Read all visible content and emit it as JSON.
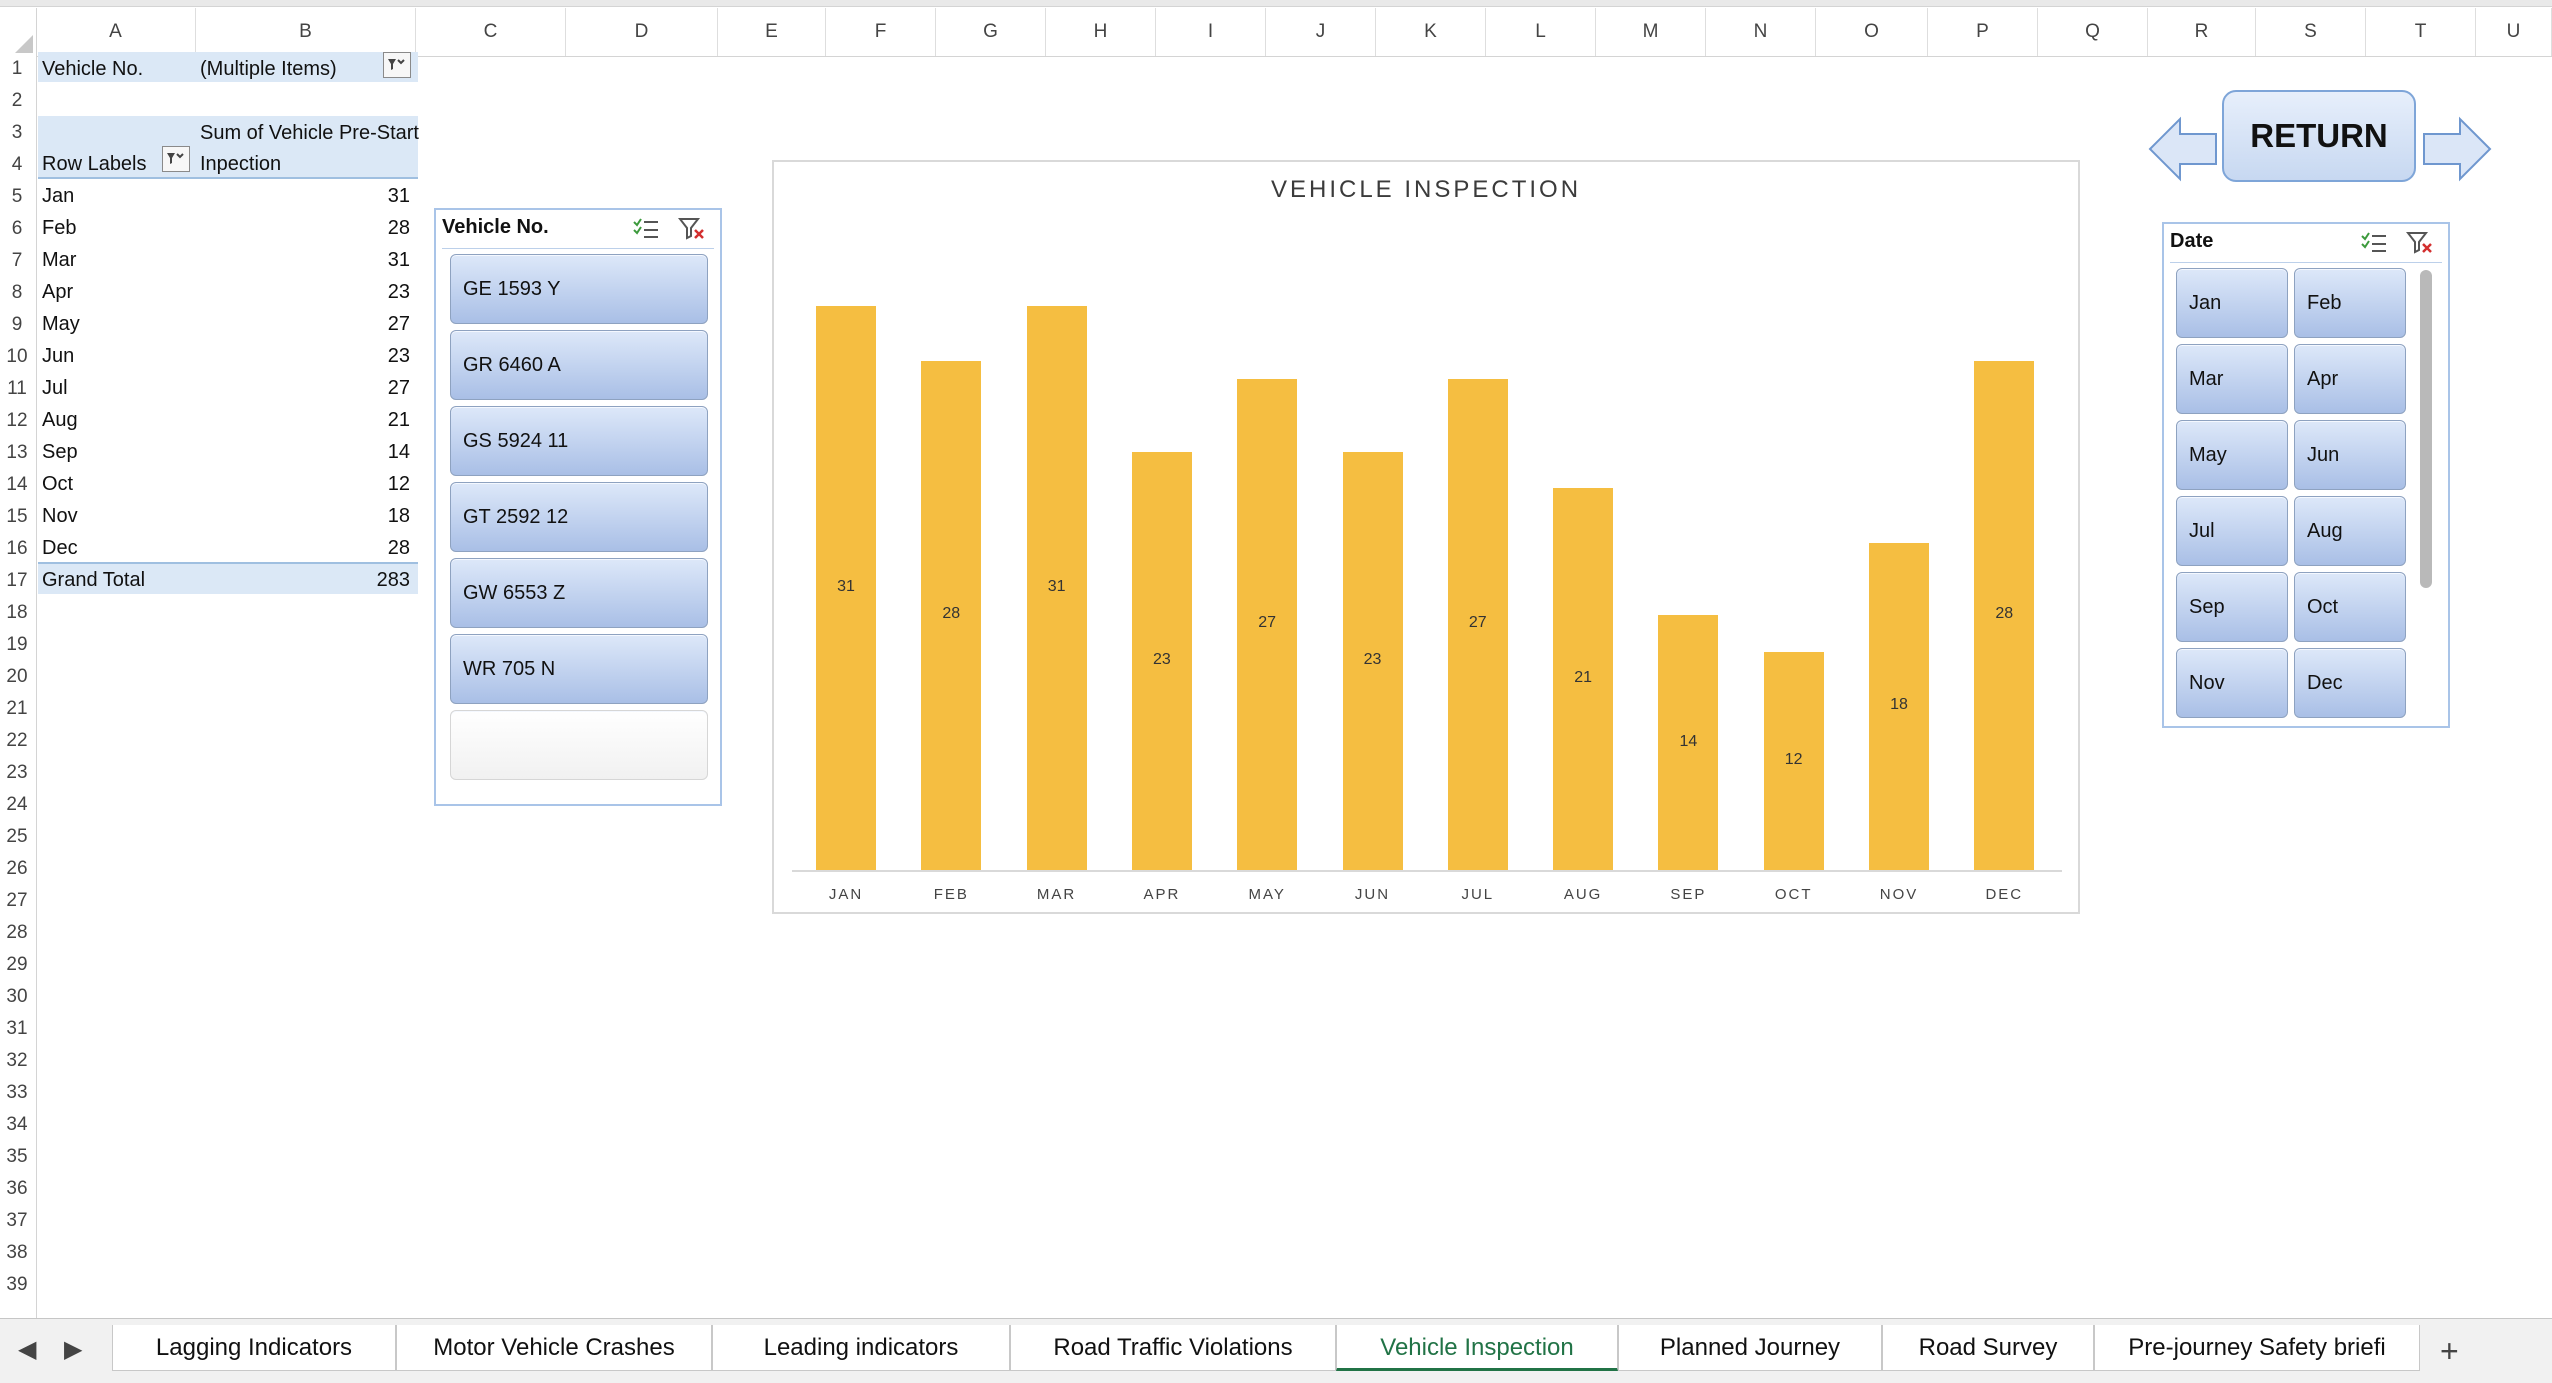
{
  "columns": [
    "A",
    "B",
    "C",
    "D",
    "E",
    "F",
    "G",
    "H",
    "I",
    "J",
    "K",
    "L",
    "M",
    "N",
    "O",
    "P",
    "Q",
    "R",
    "S",
    "T",
    "U"
  ],
  "rows": [
    "1",
    "2",
    "3",
    "4",
    "5",
    "6",
    "7",
    "8",
    "9",
    "10",
    "11",
    "12",
    "13",
    "14",
    "15",
    "16",
    "17",
    "18",
    "19",
    "20",
    "21",
    "22",
    "23",
    "24",
    "25",
    "26",
    "27",
    "28",
    "29",
    "30",
    "31",
    "32",
    "33",
    "34",
    "35",
    "36",
    "37",
    "38",
    "39"
  ],
  "pivot": {
    "filter_label": "Vehicle No.",
    "filter_value": "(Multiple Items)",
    "row_labels_header": "Row Labels",
    "sum_header_line1": "Sum of Vehicle Pre-Start",
    "sum_header_line2": "Inpection",
    "months": [
      "Jan",
      "Feb",
      "Mar",
      "Apr",
      "May",
      "Jun",
      "Jul",
      "Aug",
      "Sep",
      "Oct",
      "Nov",
      "Dec"
    ],
    "values": [
      "31",
      "28",
      "31",
      "23",
      "27",
      "23",
      "27",
      "21",
      "14",
      "12",
      "18",
      "28"
    ],
    "grand_total_label": "Grand Total",
    "grand_total_value": "283"
  },
  "vehicle_slicer": {
    "title": "Vehicle No.",
    "items": [
      "GE 1593 Y",
      "GR 6460 A",
      "GS 5924 11",
      "GT 2592 12",
      "GW 6553 Z",
      "WR 705 N"
    ]
  },
  "date_slicer": {
    "title": "Date",
    "items": [
      "Jan",
      "Feb",
      "Mar",
      "Apr",
      "May",
      "Jun",
      "Jul",
      "Aug",
      "Sep",
      "Oct",
      "Nov",
      "Dec"
    ]
  },
  "return_button": {
    "label": "RETURN"
  },
  "chart_data": {
    "type": "bar",
    "title": "VEHICLE INSPECTION",
    "categories": [
      "JAN",
      "FEB",
      "MAR",
      "APR",
      "MAY",
      "JUN",
      "JUL",
      "AUG",
      "SEP",
      "OCT",
      "NOV",
      "DEC"
    ],
    "values": [
      31,
      28,
      31,
      23,
      27,
      23,
      27,
      21,
      14,
      12,
      18,
      28
    ],
    "ylim": [
      0,
      31
    ],
    "grid": false,
    "color": "#f5be41"
  },
  "tabs": [
    {
      "label": "Lagging Indicators",
      "active": false
    },
    {
      "label": "Motor Vehicle Crashes",
      "active": false
    },
    {
      "label": "Leading indicators",
      "active": false
    },
    {
      "label": "Road Traffic Violations",
      "active": false
    },
    {
      "label": "Vehicle Inspection",
      "active": true
    },
    {
      "label": "Planned Journey",
      "active": false
    },
    {
      "label": "Road Survey",
      "active": false
    },
    {
      "label": "Pre-journey Safety briefi",
      "active": false
    }
  ],
  "tab_add": "+",
  "colors": {
    "accent": "#217346",
    "slicer_item": "#b9cdef",
    "bar": "#f5be41"
  }
}
